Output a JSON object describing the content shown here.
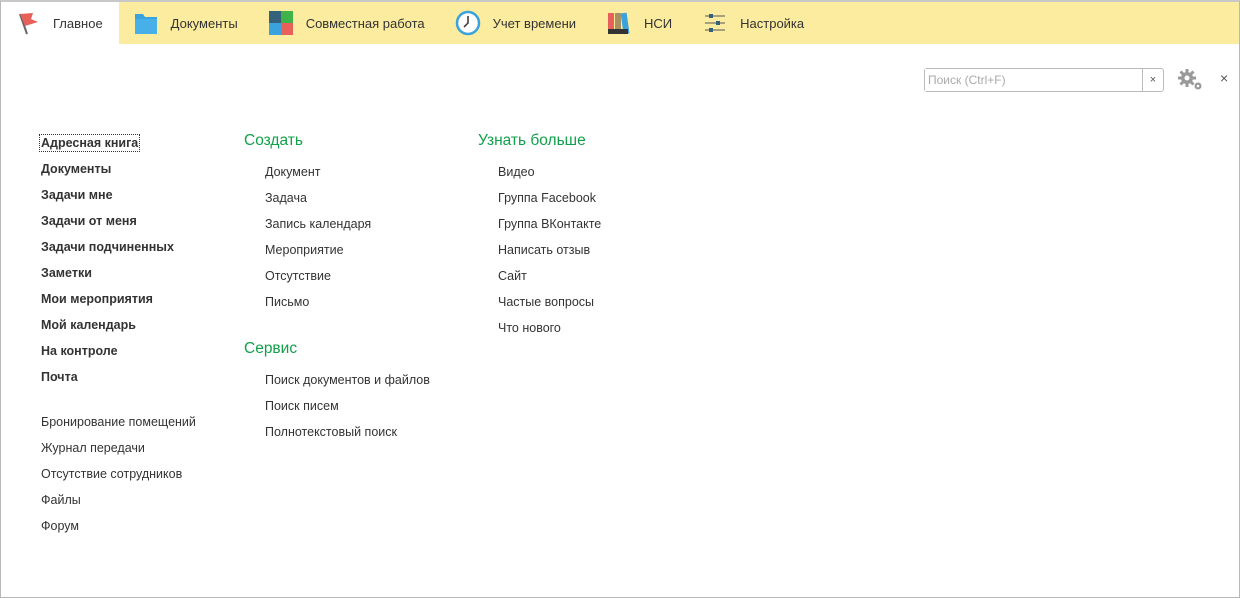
{
  "tabs": [
    {
      "label": "Главное",
      "icon": "flag-icon"
    },
    {
      "label": "Документы",
      "icon": "folder-icon"
    },
    {
      "label": "Совместная работа",
      "icon": "puzzle-icon"
    },
    {
      "label": "Учет времени",
      "icon": "clock-icon"
    },
    {
      "label": "НСИ",
      "icon": "binders-icon"
    },
    {
      "label": "Настройка",
      "icon": "sliders-icon"
    }
  ],
  "search": {
    "placeholder": "Поиск (Ctrl+F)",
    "clear": "×"
  },
  "close": "×",
  "main_links": [
    "Адресная книга",
    "Документы",
    "Задачи мне",
    "Задачи от меня",
    "Задачи подчиненных",
    "Заметки",
    "Мои мероприятия",
    "Мой календарь",
    "На контроле",
    "Почта"
  ],
  "other_links": [
    "Бронирование помещений",
    "Журнал передачи",
    "Отсутствие сотрудников",
    "Файлы",
    "Форум"
  ],
  "create": {
    "title": "Создать",
    "items": [
      "Документ",
      "Задача",
      "Запись календаря",
      "Мероприятие",
      "Отсутствие",
      "Письмо"
    ]
  },
  "service": {
    "title": "Сервис",
    "items": [
      "Поиск документов и файлов",
      "Поиск писем",
      "Полнотекстовый поиск"
    ]
  },
  "more": {
    "title": "Узнать больше",
    "items": [
      "Видео",
      "Группа Facebook",
      "Группа ВКонтакте",
      "Написать отзыв",
      "Сайт",
      "Частые вопросы",
      "Что нового"
    ]
  },
  "colors": {
    "topbar": "#fbec9f",
    "heading": "#12a04a"
  }
}
